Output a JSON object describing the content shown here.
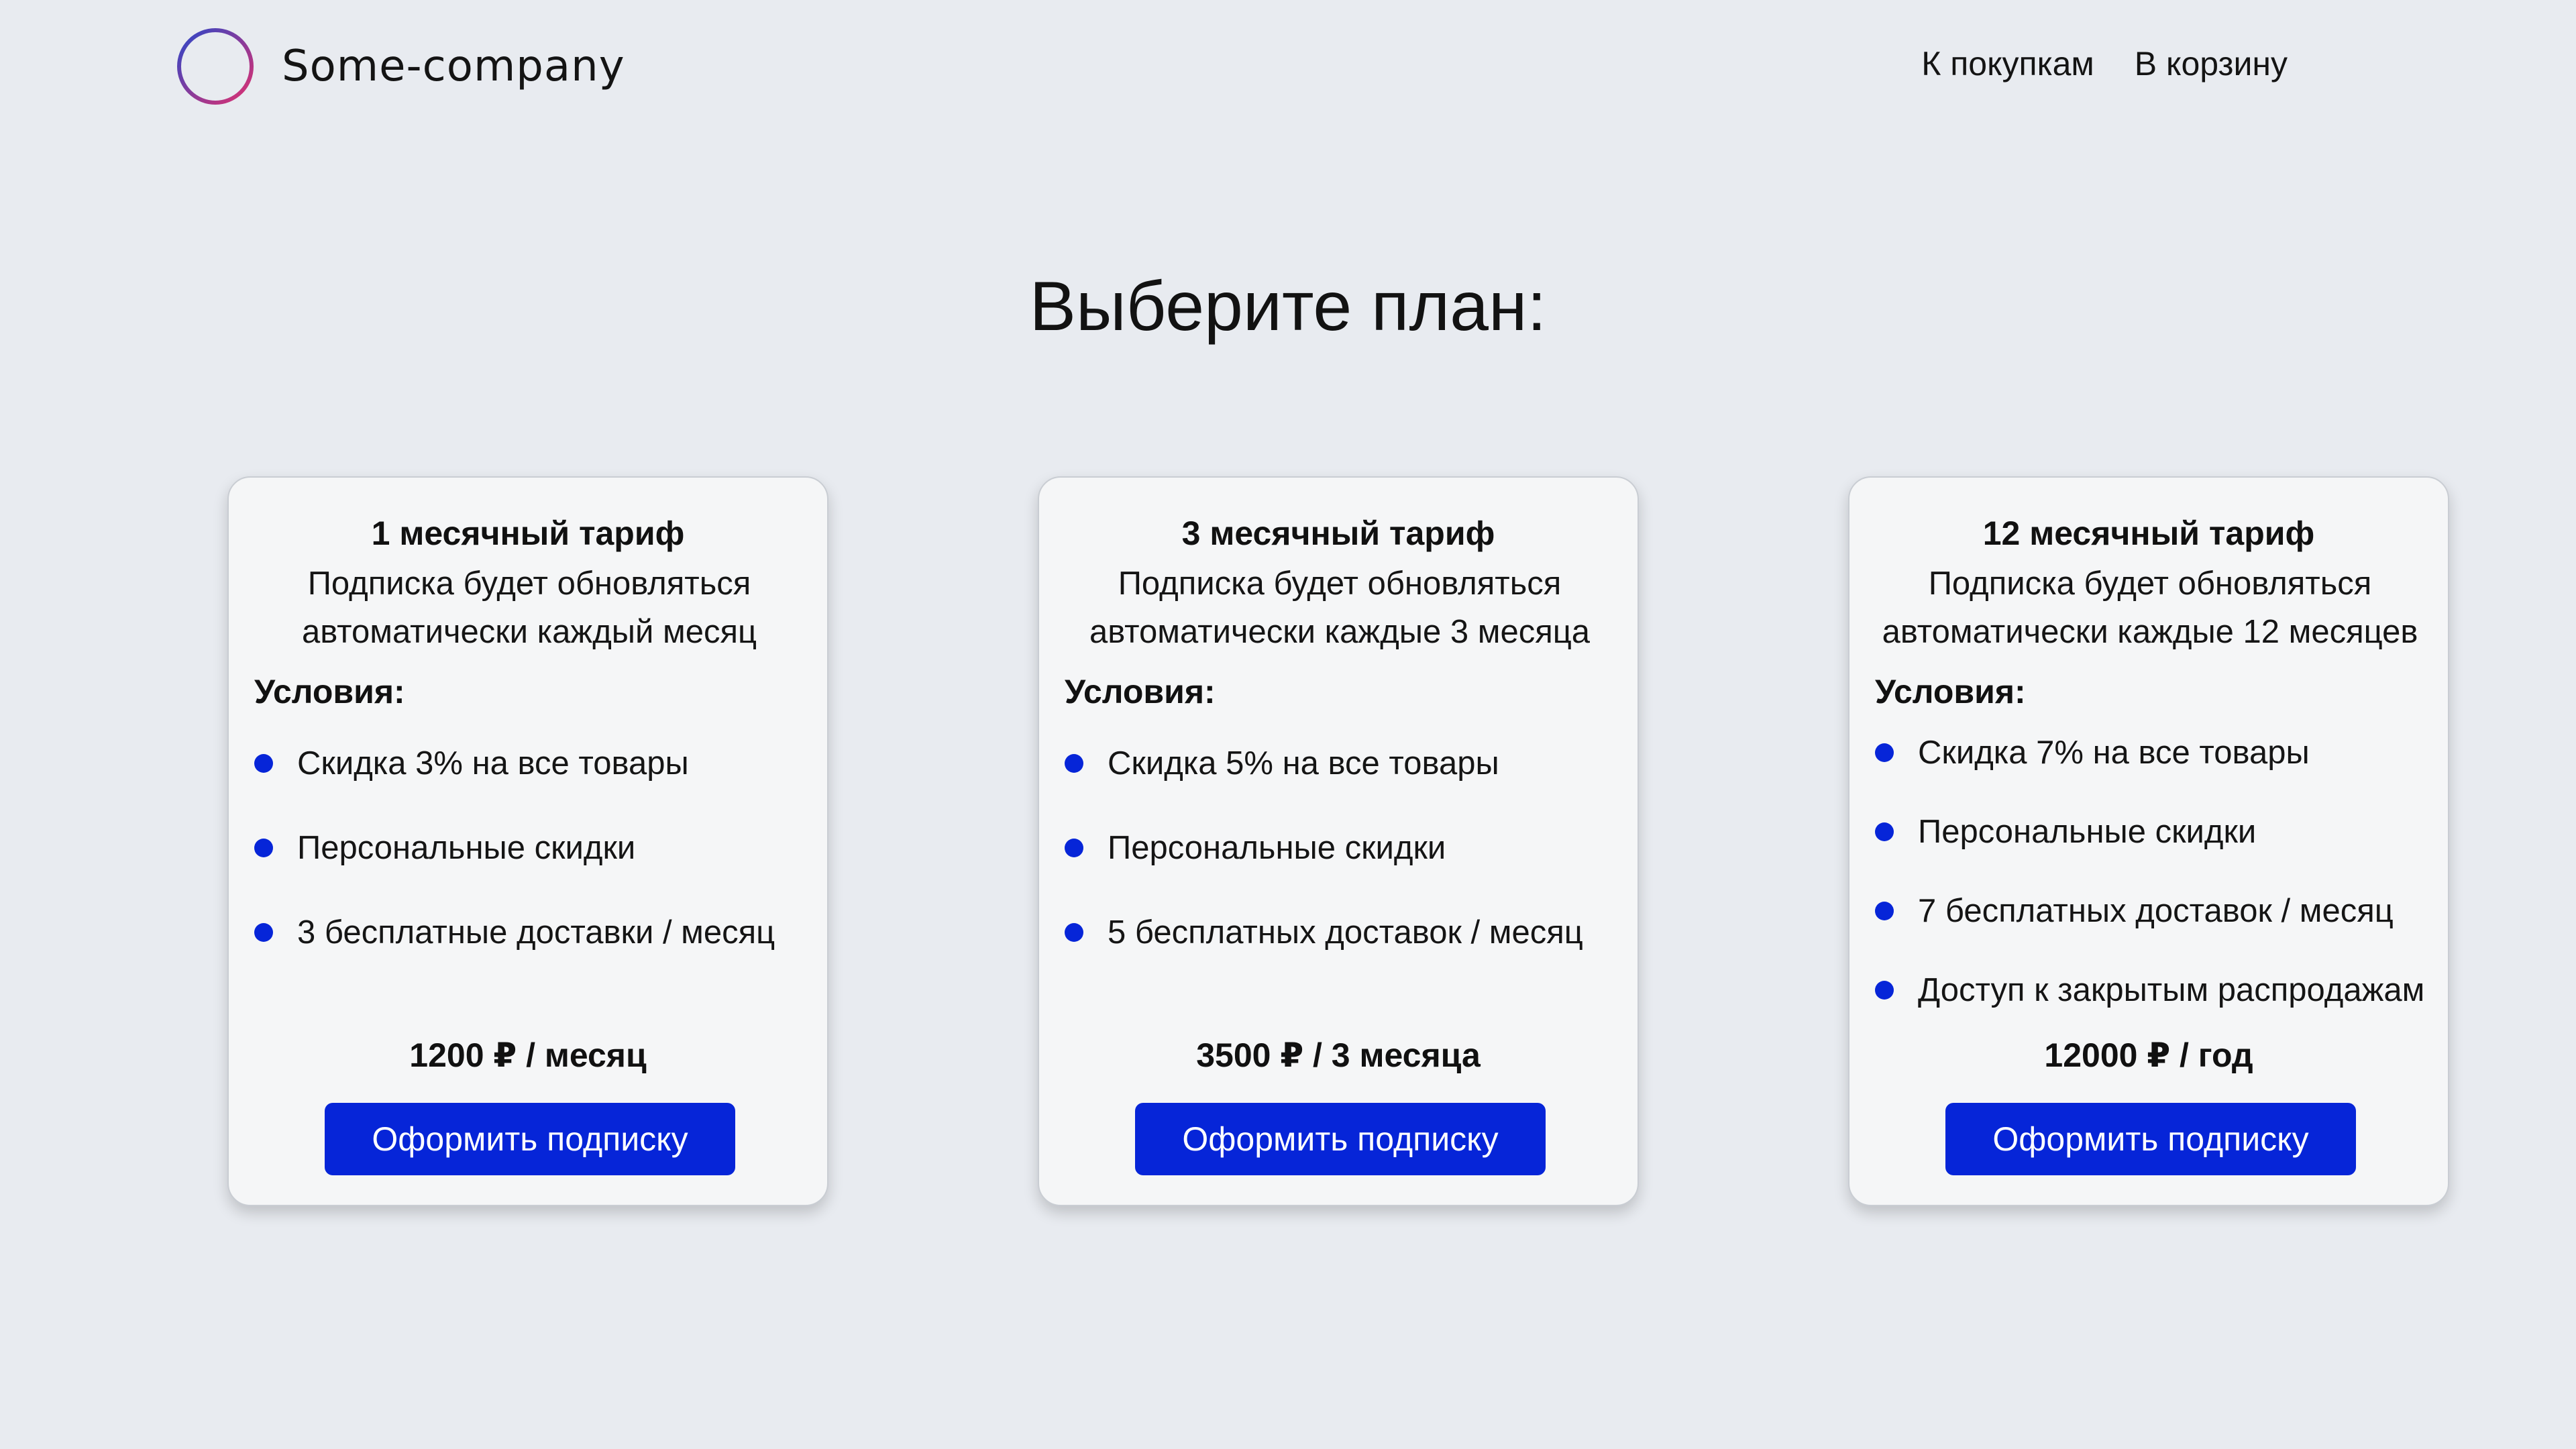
{
  "header": {
    "brand": "Some-company",
    "nav": {
      "shop": "К покупкам",
      "cart": "В корзину"
    }
  },
  "page": {
    "title": "Выберите план:"
  },
  "colors": {
    "accent": "#0625d8",
    "background": "#e8ebf0",
    "card": "#f5f6f7"
  },
  "plans": [
    {
      "title": "1 месячный тариф",
      "desc_line1": "Подписка будет обновляться",
      "desc_line2": "автоматически каждый месяц",
      "conditions_label": "Условия:",
      "perks": [
        "Скидка 3% на все товары",
        "Персональные скидки",
        "3 бесплатные доставки / месяц"
      ],
      "price": "1200 ₽ / месяц",
      "button": "Оформить подписку"
    },
    {
      "title": "3 месячный тариф",
      "desc_line1": "Подписка будет обновляться",
      "desc_line2": "автоматически каждые 3 месяца",
      "conditions_label": "Условия:",
      "perks": [
        "Скидка 5% на все товары",
        "Персональные скидки",
        "5 бесплатных доставок / месяц"
      ],
      "price": "3500 ₽ /  3 месяца",
      "button": "Оформить подписку"
    },
    {
      "title": "12 месячный тариф",
      "desc_line1": "Подписка будет обновляться",
      "desc_line2": "автоматически каждые 12 месяцев",
      "conditions_label": "Условия:",
      "perks": [
        "Скидка 7% на все товары",
        "Персональные скидки",
        "7 бесплатных доставок / месяц",
        "Доступ к закрытым распродажам"
      ],
      "price": "12000 ₽ /  год",
      "button": "Оформить подписку"
    }
  ]
}
